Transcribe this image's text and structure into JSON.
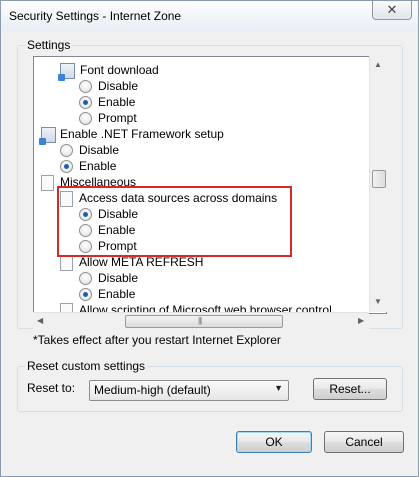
{
  "window": {
    "title": "Security Settings - Internet Zone",
    "close_label": "✕"
  },
  "settings_group": {
    "label": "Settings",
    "items": [
      {
        "label": "Font download"
      },
      {
        "label": "Disable"
      },
      {
        "label": "Enable"
      },
      {
        "label": "Prompt"
      },
      {
        "label": "Enable .NET Framework setup"
      },
      {
        "label": "Disable"
      },
      {
        "label": "Enable"
      },
      {
        "label": "Miscellaneous"
      },
      {
        "label": "Access data sources across domains"
      },
      {
        "label": "Disable"
      },
      {
        "label": "Enable"
      },
      {
        "label": "Prompt"
      },
      {
        "label": "Allow META REFRESH"
      },
      {
        "label": "Disable"
      },
      {
        "label": "Enable"
      },
      {
        "label": "Allow scripting of Microsoft web browser control"
      }
    ],
    "note": "*Takes effect after you restart Internet Explorer"
  },
  "reset_group": {
    "label": "Reset custom settings",
    "reset_to_label": "Reset to:",
    "dropdown_value": "Medium-high (default)",
    "reset_button": "Reset..."
  },
  "buttons": {
    "ok": "OK",
    "cancel": "Cancel"
  }
}
